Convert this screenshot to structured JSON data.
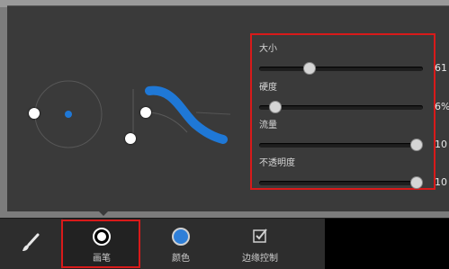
{
  "preview": {
    "stroke_color": "#1f78d6",
    "dot_color": "#1f78d6"
  },
  "sliders": [
    {
      "label": "大小",
      "value_text": "61",
      "level": 0.31
    },
    {
      "label": "硬度",
      "value_text": "6%",
      "level": 0.1
    },
    {
      "label": "流量",
      "value_text": "10",
      "level": 0.96
    },
    {
      "label": "不透明度",
      "value_text": "10",
      "level": 0.96
    }
  ],
  "toolbar": {
    "brush_tab": "画笔",
    "color_tab": "颜色",
    "edge_tab": "边缘控制"
  },
  "colors": {
    "highlight": "#d81a1a",
    "accent": "#2f7fd8"
  }
}
